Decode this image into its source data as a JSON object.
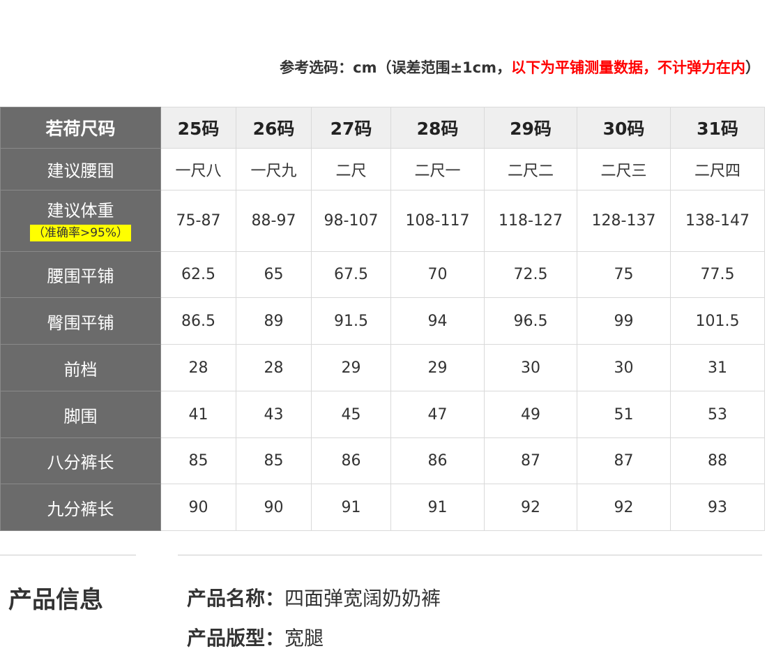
{
  "note": {
    "prefix": "参考选码：cm（误差范围±1cm，",
    "highlight": "以下为平铺测量数据，不计弹力在内",
    "suffix": "）",
    "highlight_color": "#ff0000"
  },
  "table": {
    "corner_label": "若荷尺码",
    "sizes": [
      "25码",
      "26码",
      "27码",
      "28码",
      "29码",
      "30码",
      "31码"
    ],
    "rows": [
      {
        "label": "建议腰围",
        "values": [
          "一尺八",
          "一尺九",
          "二尺",
          "二尺一",
          "二尺二",
          "二尺三",
          "二尺四"
        ]
      },
      {
        "label": "建议体重",
        "sublabel": "（准确率>95%）",
        "values": [
          "75-87",
          "88-97",
          "98-107",
          "108-117",
          "118-127",
          "128-137",
          "138-147"
        ]
      },
      {
        "label": "腰围平铺",
        "values": [
          "62.5",
          "65",
          "67.5",
          "70",
          "72.5",
          "75",
          "77.5"
        ]
      },
      {
        "label": "臀围平铺",
        "values": [
          "86.5",
          "89",
          "91.5",
          "94",
          "96.5",
          "99",
          "101.5"
        ]
      },
      {
        "label": "前档",
        "values": [
          "28",
          "28",
          "29",
          "29",
          "30",
          "30",
          "31"
        ]
      },
      {
        "label": "脚围",
        "values": [
          "41",
          "43",
          "45",
          "47",
          "49",
          "51",
          "53"
        ]
      },
      {
        "label": "八分裤长",
        "values": [
          "85",
          "85",
          "86",
          "86",
          "87",
          "87",
          "88"
        ]
      },
      {
        "label": "九分裤长",
        "values": [
          "90",
          "90",
          "91",
          "91",
          "92",
          "92",
          "93"
        ]
      }
    ],
    "header_bg": "#6b6b6b",
    "highlight_bg": "#ffff00"
  },
  "product": {
    "section_title": "产品信息",
    "name_key": "产品名称：",
    "name_value": "四面弹宽阔奶奶裤",
    "type_key": "产品版型：",
    "type_value": "宽腿"
  }
}
